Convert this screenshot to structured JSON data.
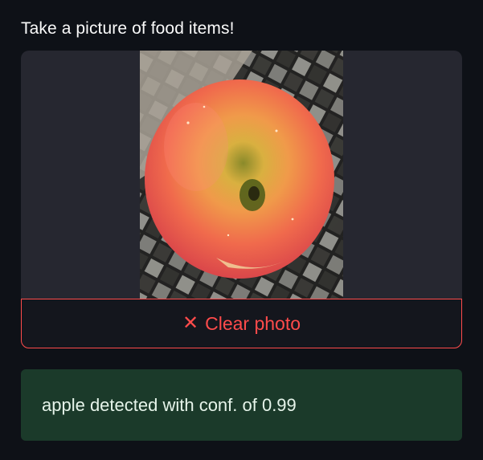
{
  "camera_input": {
    "label": "Take a picture of food items!",
    "clear_button_label": "Clear photo",
    "clear_icon": "close-icon",
    "photo_subject": "apple-photo"
  },
  "result": {
    "message": "apple detected with conf. of 0.99",
    "background_color": "#1b3a2a"
  },
  "colors": {
    "page_bg": "#0e1117",
    "panel_bg": "#262730",
    "accent": "#ff4b4b"
  }
}
